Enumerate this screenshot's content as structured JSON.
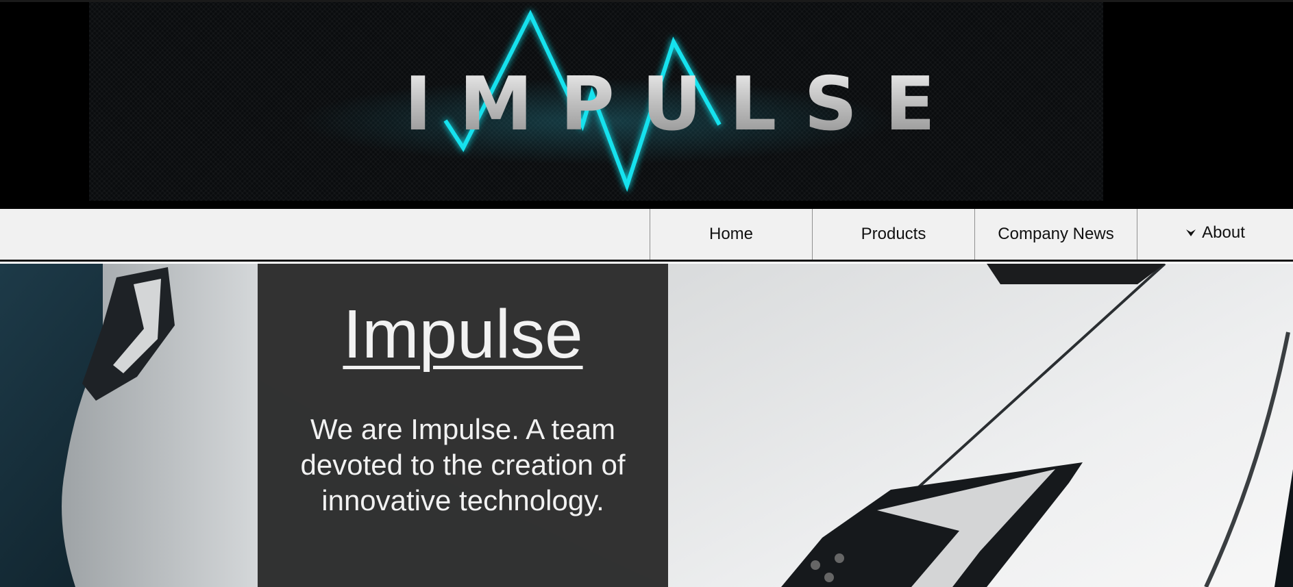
{
  "banner": {
    "logo_text": "IMPULSE",
    "accent_color": "#12e2ee"
  },
  "nav": {
    "items": [
      {
        "label": "Home"
      },
      {
        "label": "Products"
      },
      {
        "label": "Company News"
      },
      {
        "label": "About",
        "icon": "chevron-down-icon"
      }
    ]
  },
  "hero": {
    "title": "Impulse",
    "description": "We are Impulse. A team devoted to the creation of innovative technology.",
    "panel_color": "#2c2c2c"
  }
}
